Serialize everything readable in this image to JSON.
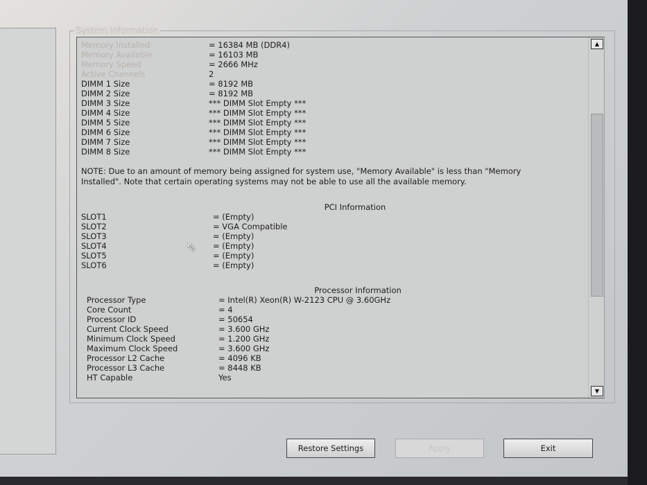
{
  "group_title": "System Information",
  "memory": [
    {
      "label": "Memory Installed",
      "value": "= 16384 MB (DDR4)"
    },
    {
      "label": "Memory Available",
      "value": "= 16103 MB"
    },
    {
      "label": "Memory Speed",
      "value": "= 2666 MHz"
    },
    {
      "label": "Active Channels",
      "value": "2"
    },
    {
      "label": "DIMM 1 Size",
      "value": "= 8192 MB"
    },
    {
      "label": "DIMM 2 Size",
      "value": "= 8192 MB"
    },
    {
      "label": "DIMM 3 Size",
      "value": "*** DIMM Slot Empty ***"
    },
    {
      "label": "DIMM 4 Size",
      "value": "*** DIMM Slot Empty ***"
    },
    {
      "label": "DIMM 5 Size",
      "value": "*** DIMM Slot Empty ***"
    },
    {
      "label": "DIMM 6 Size",
      "value": "*** DIMM Slot Empty ***"
    },
    {
      "label": "DIMM 7 Size",
      "value": "*** DIMM Slot Empty ***"
    },
    {
      "label": "DIMM 8 Size",
      "value": "*** DIMM Slot Empty ***"
    }
  ],
  "note": "NOTE: Due to an amount of memory being assigned for system use, \"Memory Available\" is less than \"Memory Installed\". Note that certain operating systems may not be able to use all the available memory.",
  "pci": {
    "title": "PCI Information",
    "rows": [
      {
        "label": "SLOT1",
        "value": "= (Empty)"
      },
      {
        "label": "SLOT2",
        "value": "= VGA Compatible"
      },
      {
        "label": "SLOT3",
        "value": "= (Empty)"
      },
      {
        "label": "SLOT4",
        "value": "= (Empty)"
      },
      {
        "label": "SLOT5",
        "value": "= (Empty)"
      },
      {
        "label": "SLOT6",
        "value": "= (Empty)"
      }
    ]
  },
  "processor": {
    "title": "Processor Information",
    "rows": [
      {
        "label": "Processor Type",
        "value": "= Intel(R) Xeon(R) W-2123 CPU @ 3.60GHz"
      },
      {
        "label": "Core Count",
        "value": "= 4"
      },
      {
        "label": "Processor ID",
        "value": "= 50654"
      },
      {
        "label": "Current Clock Speed",
        "value": "= 3.600 GHz"
      },
      {
        "label": "Minimum Clock Speed",
        "value": "= 1.200 GHz"
      },
      {
        "label": "Maximum Clock Speed",
        "value": "= 3.600 GHz"
      },
      {
        "label": "Processor L2 Cache",
        "value": "= 4096 KB"
      },
      {
        "label": "Processor L3 Cache",
        "value": "= 8448 KB"
      },
      {
        "label": "HT Capable",
        "value": "Yes"
      }
    ]
  },
  "buttons": {
    "restore": "Restore Settings",
    "apply": "Apply",
    "exit": "Exit"
  },
  "scroll_position_percent": 15
}
